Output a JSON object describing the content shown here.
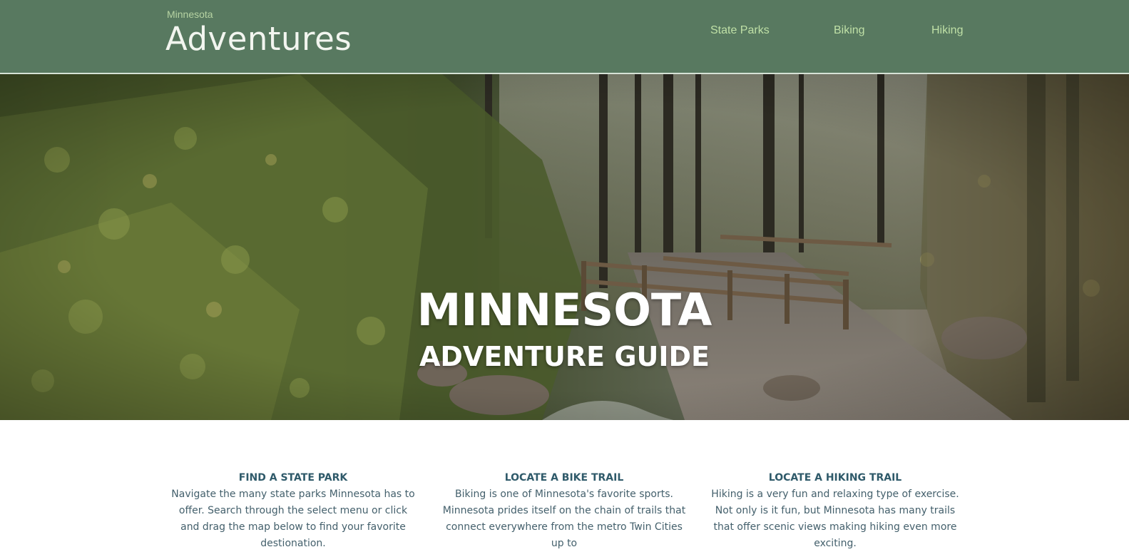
{
  "header": {
    "brand_small": "Minnesota",
    "brand_large": "Adventures",
    "nav": [
      {
        "label": "State Parks"
      },
      {
        "label": "Biking"
      },
      {
        "label": "Hiking"
      }
    ]
  },
  "hero": {
    "title": "MINNESOTA",
    "subtitle": "ADVENTURE GUIDE"
  },
  "features": [
    {
      "heading": "FIND A STATE PARK",
      "text": "Navigate the many state parks Minnesota has to offer. Search through the select menu or click and drag the map below to find your favorite destionation."
    },
    {
      "heading": "LOCATE A BIKE TRAIL",
      "text": "Biking is one of Minnesota's favorite sports. Minnesota prides itself on the chain of trails that connect everywhere from the metro Twin Cities up to"
    },
    {
      "heading": "LOCATE A HIKING TRAIL",
      "text": "Hiking is a very fun and relaxing type of exercise. Not only is it fun, but Minnesota has many trails that offer scenic views making hiking even more exciting."
    }
  ],
  "colors": {
    "header_bg": "#587960",
    "nav_link": "#bfe0a6",
    "heading": "#2f5a6a",
    "body_text": "#44606c"
  }
}
